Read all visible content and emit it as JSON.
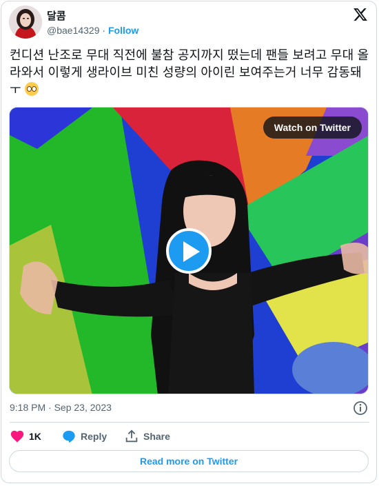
{
  "author": {
    "name": "달콤",
    "handle": "@bae14329",
    "separator": "·",
    "follow_label": "Follow"
  },
  "tweet": {
    "text": "컨디션 난조로 무대 직전에 불참 공지까지 떴는데 팬들 보려고 무대 올라와서 이렇게 생라이브 미친 성량의 아이린 보여주는거 너무 감동돼ㅜ"
  },
  "media": {
    "watch_label": "Watch on Twitter"
  },
  "meta": {
    "time": "9:18 PM",
    "separator": "·",
    "date": "Sep 23, 2023"
  },
  "actions": {
    "like_count": "1K",
    "reply_label": "Reply",
    "share_label": "Share"
  },
  "footer": {
    "read_more_label": "Read more on Twitter"
  },
  "colors": {
    "accent": "#1d9bf0",
    "like": "#f91880",
    "muted": "#536471"
  }
}
